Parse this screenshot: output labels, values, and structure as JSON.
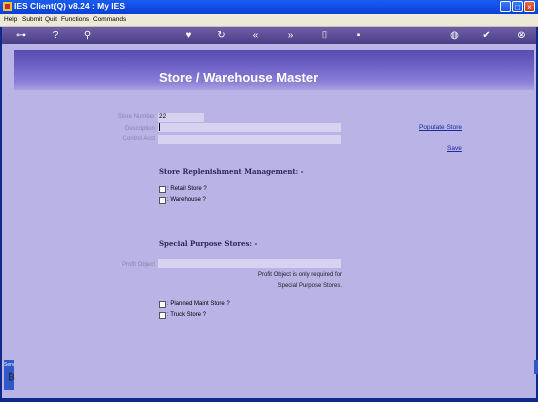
{
  "window": {
    "title": "IES Client(Q) v8.24 : My IES"
  },
  "menu": [
    "Help",
    "Submit",
    "Quit",
    "Functions",
    "Commands"
  ],
  "toolbar": {
    "icons": [
      "key-icon",
      "help-icon",
      "search-icon",
      "heart-icon",
      "refresh-icon",
      "rewind-icon",
      "forward-icon",
      "doc-icon",
      "page-icon",
      "globe-icon",
      "check-icon",
      "close-icon"
    ]
  },
  "page": {
    "title": "Store / Warehouse Master"
  },
  "fields": {
    "store_number_label": "Store Number",
    "store_number_value": "22",
    "description_label": "Description",
    "description_value": "",
    "control_acct_label": "Control Acct",
    "control_acct_value": ""
  },
  "actions": {
    "populate_store": "Populate Store",
    "save": "Save"
  },
  "replenishment": {
    "heading": "Store Replenishment Management: -",
    "retail_store": ": Retail Store ?",
    "warehouse": ": Warehouse ?"
  },
  "special": {
    "heading": "Special Purpose Stores: -",
    "profit_object_label": "Profit Object",
    "profit_object_value": "",
    "note_line1": "Profit Object is only required for",
    "note_line2": "Special Purpose Stores.",
    "planned_maint": ": Planned Maint Store ?",
    "truck_store": ": Truck Store ?"
  },
  "side_panel": {
    "handle_text": "Serv"
  }
}
